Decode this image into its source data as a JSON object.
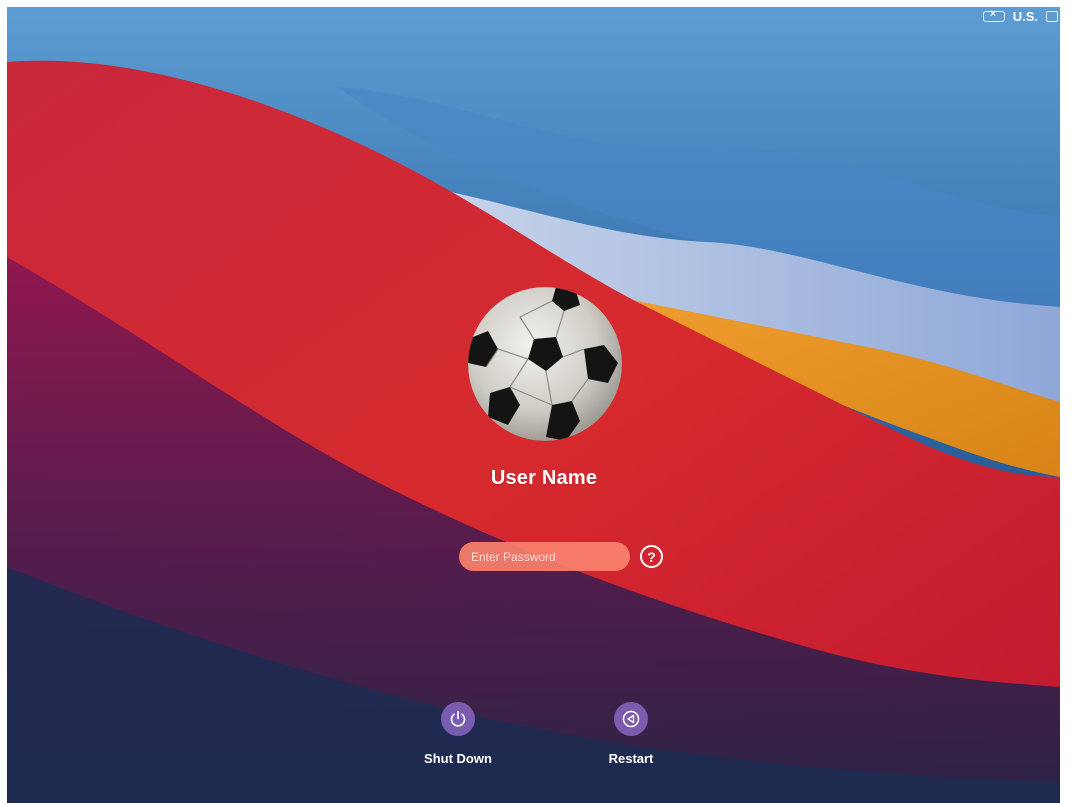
{
  "menubar": {
    "keyboard_icon": "keyboard-icon",
    "input_language": "U.S.",
    "language_icon": "input-source-icon"
  },
  "login": {
    "avatar_icon": "soccer-ball-avatar",
    "user_name": "User Name",
    "password_placeholder": "Enter Password",
    "password_value": "",
    "help_symbol": "?"
  },
  "actions": {
    "shutdown_label": "Shut Down",
    "shutdown_icon": "power-icon",
    "restart_label": "Restart",
    "restart_icon": "restart-icon"
  },
  "colors": {
    "password_field": "#fa806c",
    "action_button": "#966ed2",
    "wallpaper_red": "#c8102e",
    "wallpaper_blue": "#2f6aa6",
    "wallpaper_orange": "#e8902a"
  }
}
